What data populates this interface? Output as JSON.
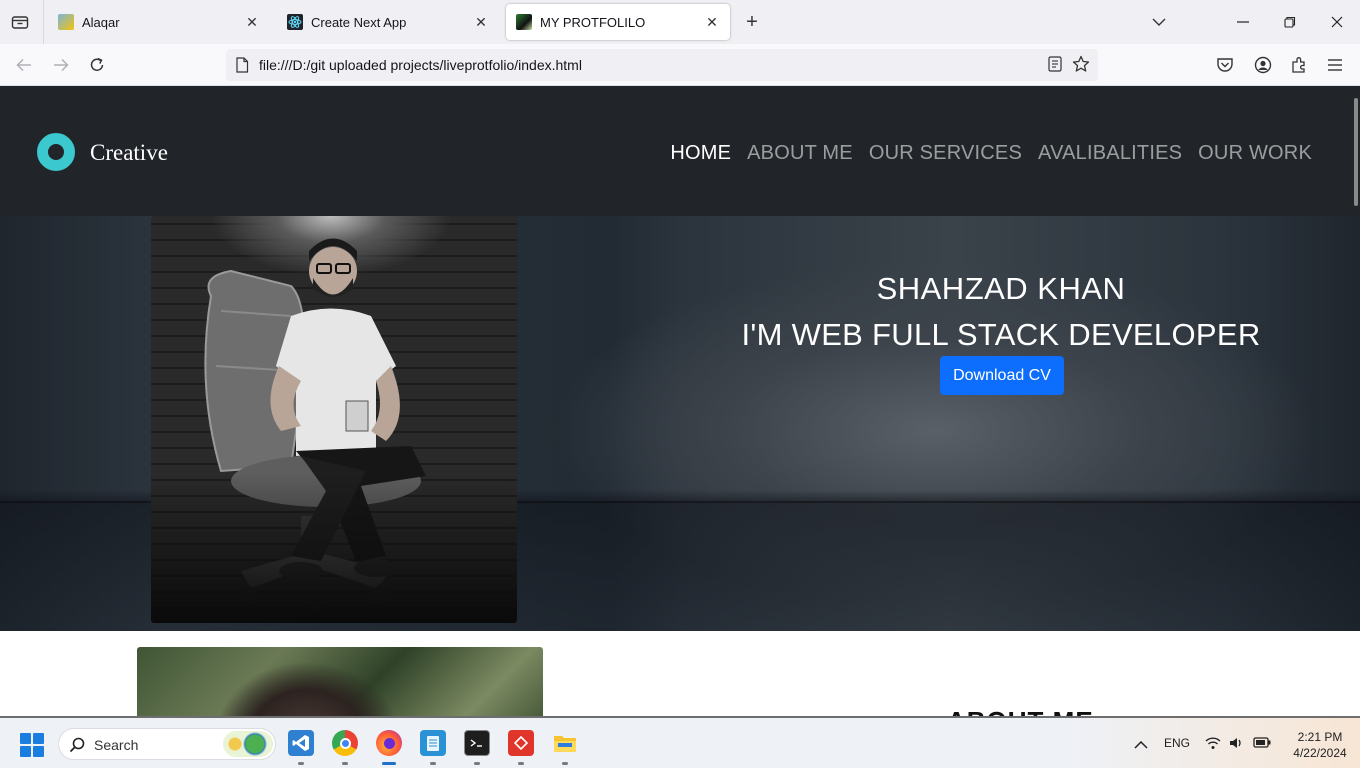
{
  "browser": {
    "tabs": [
      {
        "title": "Alaqar",
        "active": false
      },
      {
        "title": "Create Next App",
        "active": false
      },
      {
        "title": "MY PROTFOLILO",
        "active": true
      }
    ],
    "url": "file:///D:/git uploaded projects/liveprotfolio/index.html"
  },
  "site": {
    "logo_text": "Creative",
    "menu": [
      "HOME",
      "ABOUT ME",
      "OUR SERVICES",
      "AVALIBALITIES",
      "OUR WORK"
    ],
    "active_menu": "HOME",
    "hero": {
      "name": "SHAHZAD KHAN",
      "role": "I'M WEB FULL STACK DEVELOPER",
      "cta": "Download CV"
    },
    "about_title": "ABOUT ME"
  },
  "taskbar": {
    "search_label": "Search",
    "tray_lang": "ENG",
    "time": "2:21 PM",
    "date": "4/22/2024"
  },
  "colors": {
    "header_bg": "#212529",
    "logo_accent": "#3cc8cf",
    "button_blue": "#0d6efd"
  }
}
